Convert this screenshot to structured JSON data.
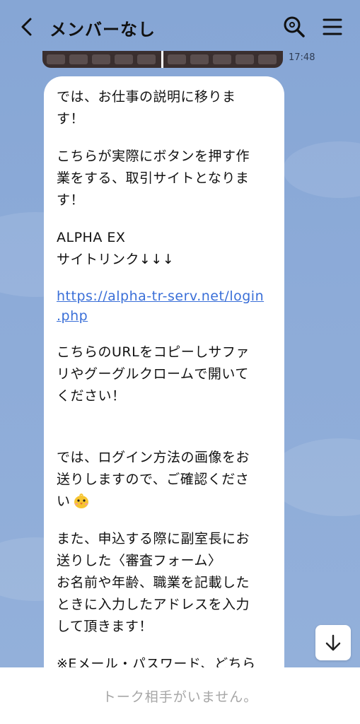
{
  "header": {
    "title": "メンバーなし",
    "back_icon": "chevron-left-icon",
    "search_icon": "search-icon",
    "menu_icon": "hamburger-menu-icon"
  },
  "previous_message": {
    "time": "17:48"
  },
  "message": {
    "lines": [
      "では、お仕事の説明に移りま\nす！",
      "こちらが実際にボタンを押す作\n業をする、取引サイトとなりま\nす！",
      "ALPHA EX\nサイトリンク↓↓↓",
      "https://alpha-tr-serv.net/login\n.php",
      "こちらのURLをコピーしサファ\nリやグーグルクロームで開いて\nください！",
      "では、ログイン方法の画像をお\n送りしますので、ご確認くださ\nい",
      "また、申込する際に副室長にお\n送りした〈審査フォーム〉\nお名前や年齢、職業を記載した\nときに入力したアドレスを入力\nして頂きます！",
      "※Eメール・パスワード、どちら"
    ],
    "emoji": "chick-emoji"
  },
  "scroll_button": {
    "icon": "arrow-down-icon"
  },
  "input_bar": {
    "placeholder": "トーク相手がいません。"
  },
  "colors": {
    "background": "#8aa9d6",
    "bubble": "#ffffff",
    "link": "#3a6fd8",
    "placeholder": "#a6a6a6"
  }
}
